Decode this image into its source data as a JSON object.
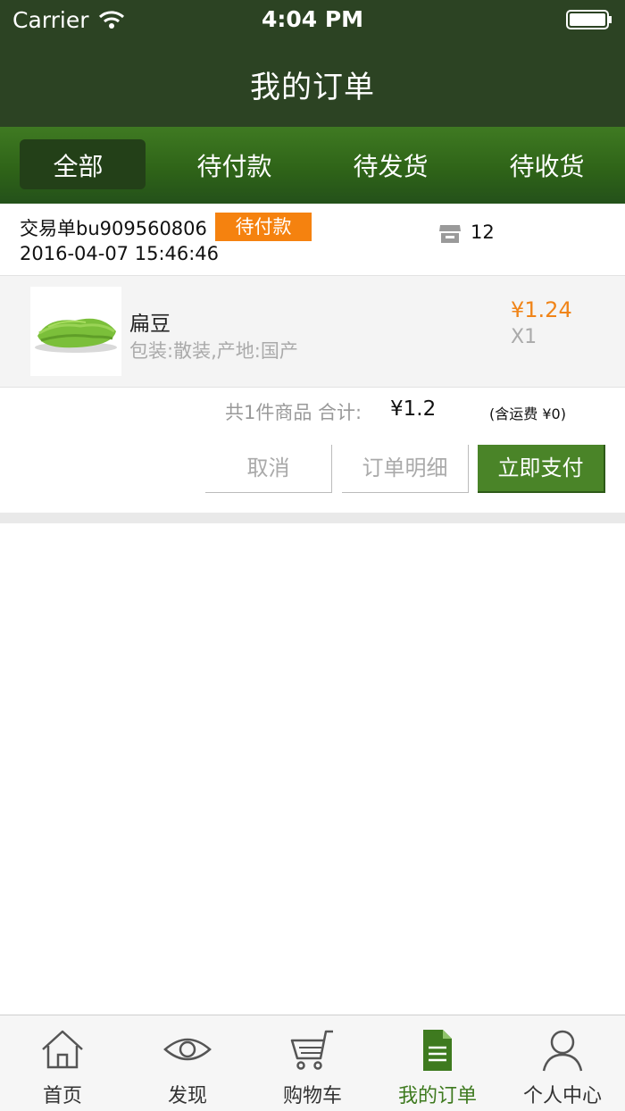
{
  "status_bar": {
    "carrier": "Carrier",
    "time": "4:04 PM"
  },
  "nav": {
    "title": "我的订单"
  },
  "tabs": [
    {
      "label": "全部",
      "active": true
    },
    {
      "label": "待付款",
      "active": false
    },
    {
      "label": "待发货",
      "active": false
    },
    {
      "label": "待收货",
      "active": false
    }
  ],
  "order": {
    "number": "交易单bu909560806",
    "status_badge": "待付款",
    "store_count": "12",
    "time": "2016-04-07 15:46:46",
    "item": {
      "name": "扁豆",
      "spec": "包装:散装,产地:国产",
      "price": "¥1.24",
      "qty": "X1",
      "image": "green-beans-icon"
    },
    "summary_label": "共1件商品 合计:",
    "summary_total": "¥1.2",
    "shipping": "(含运费 ¥0)",
    "buttons": {
      "cancel": "取消",
      "detail": "订单明细",
      "pay": "立即支付"
    }
  },
  "bottom_tabs": [
    {
      "label": "首页",
      "icon": "home-icon"
    },
    {
      "label": "发现",
      "icon": "eye-icon"
    },
    {
      "label": "购物车",
      "icon": "cart-icon"
    },
    {
      "label": "我的订单",
      "icon": "document-icon",
      "active": true
    },
    {
      "label": "个人中心",
      "icon": "user-icon"
    }
  ],
  "colors": {
    "header": "#2c4323",
    "tab_bar": "#2f6418",
    "accent_orange": "#f5820f",
    "pay_button": "#4a8428",
    "active_tab_text": "#3e7a1f"
  }
}
